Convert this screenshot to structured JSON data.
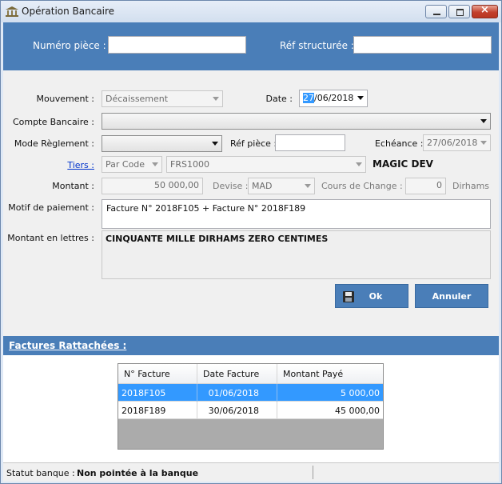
{
  "window": {
    "title": "Opération Bancaire",
    "close_glyph": "×",
    "icon": "bank-icon"
  },
  "header": {
    "numero_piece_label": "Numéro pièce :",
    "numero_piece_value": "",
    "ref_structuree_label": "Réf structurée :",
    "ref_structuree_value": ""
  },
  "form": {
    "mouvement_label": "Mouvement :",
    "mouvement_value": "Décaissement",
    "date_label": "Date :",
    "date_day": "27",
    "date_rest": "/06/2018",
    "compte_label": "Compte Bancaire :",
    "compte_value": "",
    "mode_label": "Mode Règlement :",
    "mode_value": "",
    "ref_piece_label": "Réf pièce :",
    "ref_piece_value": "",
    "echeance_label": "Echéance :",
    "echeance_value": "27/06/2018",
    "tiers_label": "Tiers :",
    "tiers_mode": "Par Code",
    "tiers_code": "FRS1000",
    "tiers_name": "MAGIC DEV",
    "montant_label": "Montant :",
    "montant_value": "50 000,00",
    "devise_label": "Devise :",
    "devise_value": "MAD",
    "cours_label": "Cours de Change :",
    "cours_value": "0",
    "cours_unit": "Dirhams",
    "motif_label": "Motif de paiement :",
    "motif_value": "Facture N° 2018F105 + Facture N° 2018F189",
    "lettres_label": "Montant en lettres :",
    "lettres_value": "CINQUANTE MILLE DIRHAMS ZERO CENTIMES"
  },
  "buttons": {
    "ok": "Ok",
    "annuler": "Annuler"
  },
  "factures": {
    "title": "Factures Rattachées :",
    "columns": [
      "N° Facture",
      "Date Facture",
      "Montant Payé"
    ],
    "rows": [
      [
        "2018F105",
        "01/06/2018",
        "5 000,00"
      ],
      [
        "2018F189",
        "30/06/2018",
        "45 000,00"
      ]
    ]
  },
  "status": {
    "label": "Statut banque :",
    "value": "Non pointée à la banque"
  }
}
